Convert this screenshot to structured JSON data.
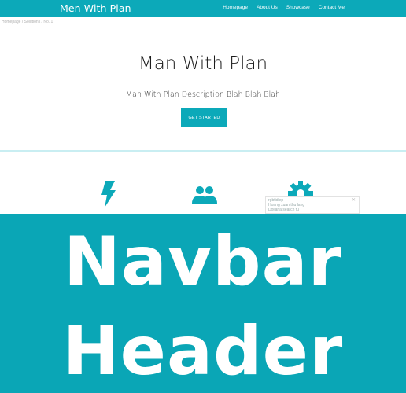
{
  "navbar": {
    "brand": "Men With Plan",
    "links": [
      "Homepage",
      "About Us",
      "Showcase",
      "Contact Me"
    ]
  },
  "breadcrumb": "Homepage / Solutions / No. 1",
  "hero": {
    "title": "Man With Plan",
    "description": "Man With Plan Description Blah Blah Blah",
    "button_label": "GET STARTED"
  },
  "features": {
    "icons": [
      "bolt-icon",
      "users-icon",
      "gear-icon"
    ]
  },
  "popup": {
    "title": "rgbtidiep",
    "line1": "Hoang xuan thu lang",
    "line2": "Dollaria search fu"
  },
  "overlay": {
    "line1": "Navbar",
    "line2": "Header"
  },
  "colors": {
    "accent": "#0ca9b9",
    "overlay": "#0aa6b6"
  }
}
